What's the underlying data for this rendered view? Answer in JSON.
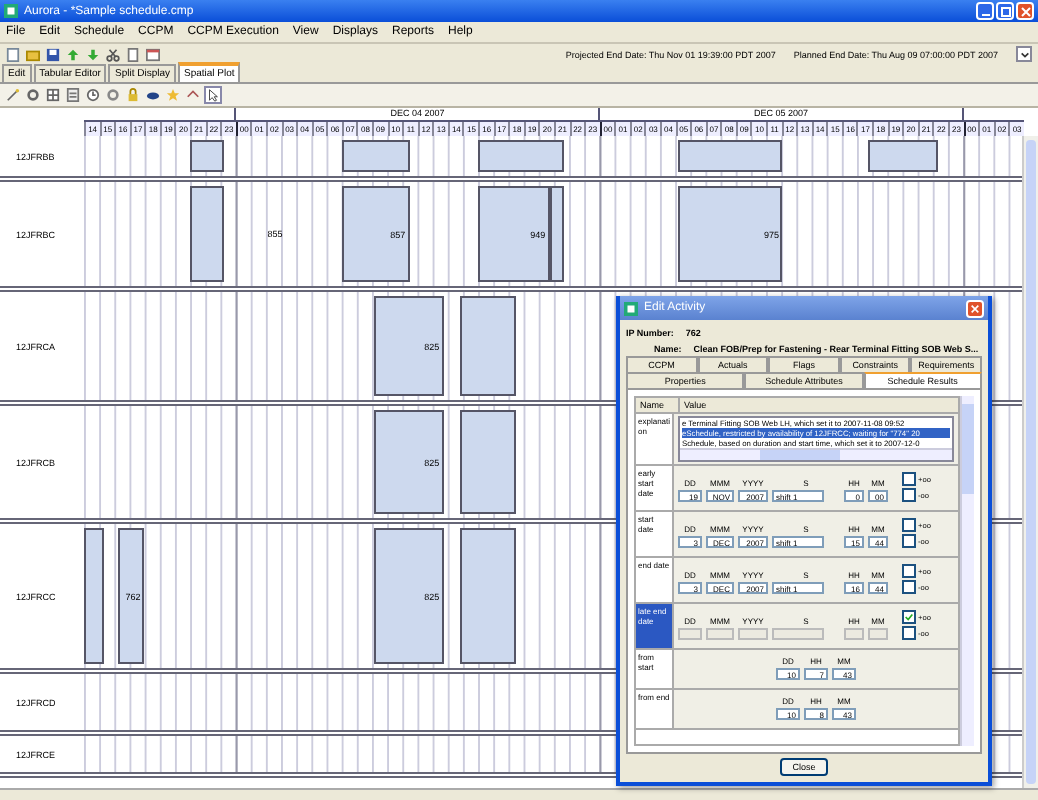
{
  "window": {
    "title": "Aurora - *Sample schedule.cmp"
  },
  "menu": [
    "File",
    "Edit",
    "Schedule",
    "CCPM",
    "CCPM Execution",
    "View",
    "Displays",
    "Reports",
    "Help"
  ],
  "end_dates": [
    "Projected End Date: Thu Nov 01 19:39:00 PDT 2007",
    "Planned End Date: Thu Aug 09 07:00:00 PDT 2007"
  ],
  "tabs": [
    {
      "label": "Edit",
      "selected": false
    },
    {
      "label": "Tabular Editor",
      "selected": false
    },
    {
      "label": "Split Display",
      "selected": false
    },
    {
      "label": "Spatial Plot",
      "selected": true
    }
  ],
  "timeline": {
    "days": [
      {
        "hours": [
          "14",
          "15",
          "16",
          "17",
          "18",
          "19",
          "20",
          "21",
          "22",
          "23"
        ]
      },
      {
        "label": "DEC 04 2007",
        "hours": [
          "00",
          "01",
          "02",
          "03",
          "04",
          "05",
          "06",
          "07",
          "08",
          "09",
          "10",
          "11",
          "12",
          "13",
          "14",
          "15",
          "16",
          "17",
          "18",
          "19",
          "20",
          "21",
          "22",
          "23"
        ]
      },
      {
        "label": "DEC 05 2007",
        "hours": [
          "00",
          "01",
          "02",
          "03",
          "04",
          "05",
          "06",
          "07",
          "08",
          "09",
          "10",
          "11",
          "12",
          "13",
          "14",
          "15",
          "16",
          "17",
          "18",
          "19",
          "20",
          "21",
          "22",
          "23"
        ]
      },
      {
        "hours": [
          "00",
          "01",
          "02",
          "03"
        ]
      }
    ]
  },
  "rows": [
    {
      "name": "12JFRBB",
      "bars": [
        {
          "kind": "bar"
        },
        {
          "kind": "bar"
        },
        {
          "kind": "bar"
        },
        {
          "kind": "bar"
        },
        {
          "kind": "bar"
        }
      ]
    },
    {
      "name": "12JFRBC",
      "bars": [
        {
          "kind": "bar"
        },
        {
          "kind": "label",
          "label": "855"
        },
        {
          "kind": "bar",
          "label": "857"
        },
        {
          "kind": "bar",
          "label": "949"
        },
        {
          "kind": "bar"
        },
        {
          "kind": "bar",
          "label": "975"
        }
      ]
    },
    {
      "name": "12JFRCA",
      "bars": [
        {
          "kind": "bar",
          "label": "825"
        },
        {
          "kind": "bar"
        }
      ]
    },
    {
      "name": "12JFRCB",
      "bars": [
        {
          "kind": "bar",
          "label": "825"
        },
        {
          "kind": "bar"
        }
      ]
    },
    {
      "name": "12JFRCC",
      "bars": [
        {
          "kind": "bar"
        },
        {
          "kind": "bar",
          "label": "762"
        },
        {
          "kind": "bar",
          "label": "825"
        },
        {
          "kind": "bar"
        }
      ]
    },
    {
      "name": "12JFRCD",
      "bars": []
    },
    {
      "name": "12JFRCE",
      "bars": []
    }
  ],
  "dialog": {
    "title": "Edit Activity",
    "ip_label": "IP Number:",
    "ip": "762",
    "name_label": "Name:",
    "name": "Clean FOB/Prep for Fastening - Rear Terminal Fitting SOB Web S...",
    "tabs_back": [
      {
        "label": "CCPM",
        "selected": false
      },
      {
        "label": "Actuals",
        "selected": false
      },
      {
        "label": "Flags",
        "selected": false
      },
      {
        "label": "Constraints",
        "selected": false
      },
      {
        "label": "Requirements",
        "selected": false
      }
    ],
    "tabs_front": [
      {
        "label": "Properties",
        "selected": false
      },
      {
        "label": "Schedule Attributes",
        "selected": false
      },
      {
        "label": "Schedule Results",
        "selected": true
      }
    ],
    "columns": [
      "Name",
      "Value"
    ],
    "rows": [
      {
        "kind": "text",
        "name": "explanati on",
        "selected": false,
        "lines": [
          {
            "text": "e Terminal Fitting SOB Web LH, which set it to 2007-11-08 09:52",
            "selected": false
          },
          {
            "text": "eSchedule, restricted by availability of 12JFRCC; waiting for \"774\" 20",
            "selected": true
          },
          {
            "text": "Schedule, based on duration and start time, which set it to 2007-12-0",
            "selected": false
          }
        ]
      },
      {
        "kind": "date",
        "name": "early start date",
        "selected": false,
        "disabled": false,
        "fields": [
          {
            "label": "DD",
            "value": "19"
          },
          {
            "label": "MMM",
            "value": "NOV"
          },
          {
            "label": "YYYY",
            "value": "2007"
          },
          {
            "label": "S",
            "value": "shift 1"
          },
          {
            "label": "HH",
            "value": "0"
          },
          {
            "label": "MM",
            "value": "00"
          }
        ],
        "checks": [
          {
            "label": "+oo",
            "checked": false
          },
          {
            "label": "-oo",
            "checked": false
          }
        ]
      },
      {
        "kind": "date",
        "name": "start date",
        "selected": false,
        "disabled": false,
        "fields": [
          {
            "label": "DD",
            "value": "3"
          },
          {
            "label": "MMM",
            "value": "DEC"
          },
          {
            "label": "YYYY",
            "value": "2007"
          },
          {
            "label": "S",
            "value": "shift 1"
          },
          {
            "label": "HH",
            "value": "15"
          },
          {
            "label": "MM",
            "value": "44"
          }
        ],
        "checks": [
          {
            "label": "+oo",
            "checked": false
          },
          {
            "label": "-oo",
            "checked": false
          }
        ]
      },
      {
        "kind": "date",
        "name": "end date",
        "selected": false,
        "disabled": false,
        "fields": [
          {
            "label": "DD",
            "value": "3"
          },
          {
            "label": "MMM",
            "value": "DEC"
          },
          {
            "label": "YYYY",
            "value": "2007"
          },
          {
            "label": "S",
            "value": "shift 1"
          },
          {
            "label": "HH",
            "value": "16"
          },
          {
            "label": "MM",
            "value": "44"
          }
        ],
        "checks": [
          {
            "label": "+oo",
            "checked": false
          },
          {
            "label": "-oo",
            "checked": false
          }
        ]
      },
      {
        "kind": "date",
        "name": "late end date",
        "selected": true,
        "disabled": true,
        "fields": [
          {
            "label": "DD"
          },
          {
            "label": "MMM"
          },
          {
            "label": "YYYY"
          },
          {
            "label": "S"
          },
          {
            "label": "HH"
          },
          {
            "label": "MM"
          }
        ],
        "checks": [
          {
            "label": "+oo",
            "checked": true
          },
          {
            "label": "-oo",
            "checked": false
          }
        ]
      },
      {
        "kind": "offset",
        "name": "from start",
        "selected": false,
        "fields": [
          {
            "label": "DD",
            "value": "10"
          },
          {
            "label": "HH",
            "value": "7"
          },
          {
            "label": "MM",
            "value": "43"
          }
        ]
      },
      {
        "kind": "offset",
        "name": "from end",
        "selected": false,
        "fields": [
          {
            "label": "DD",
            "value": "10"
          },
          {
            "label": "HH",
            "value": "8"
          },
          {
            "label": "MM",
            "value": "43"
          }
        ]
      }
    ],
    "close": "Close"
  }
}
